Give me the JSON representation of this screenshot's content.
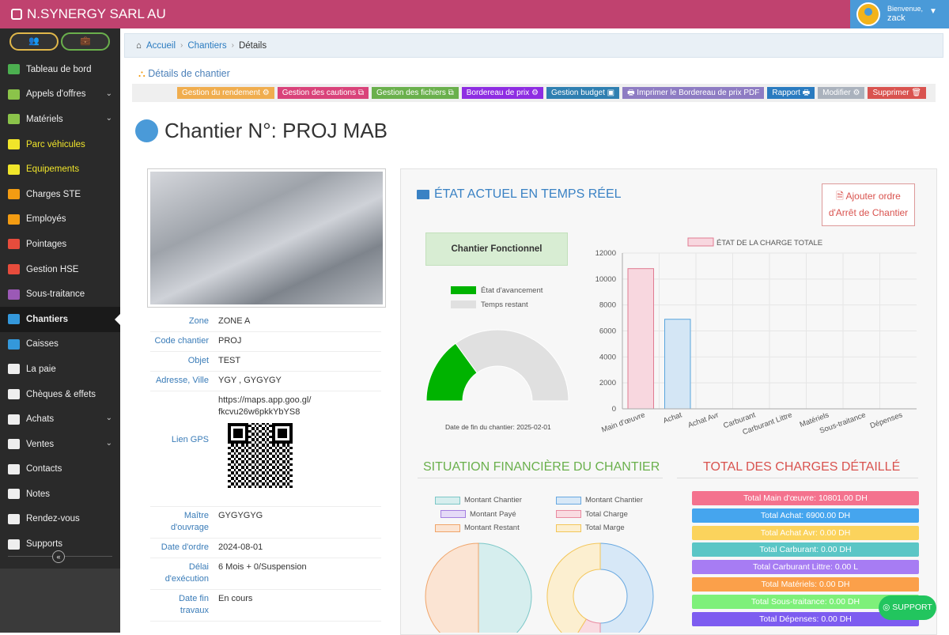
{
  "app": {
    "title": "N.SYNERGY SARL AU"
  },
  "user": {
    "greeting": "Bienvenue,",
    "name": "zack"
  },
  "sidebar": {
    "items": [
      {
        "label": "Tableau de bord",
        "icon": "dashboard-icon",
        "color": "#4caf50",
        "chev": false
      },
      {
        "label": "Appels d'offres",
        "icon": "globe-icon",
        "color": "#8bc34a",
        "chev": true
      },
      {
        "label": "Matériels",
        "icon": "tool-icon",
        "color": "#8bc34a",
        "chev": true
      },
      {
        "label": "Parc véhicules",
        "icon": "car-icon",
        "color": "#f0e52a",
        "chev": false
      },
      {
        "label": "Equipements",
        "icon": "list-icon",
        "color": "#f0e52a",
        "chev": false
      },
      {
        "label": "Charges STE",
        "icon": "building-icon",
        "color": "#f39c12",
        "chev": false
      },
      {
        "label": "Employés",
        "icon": "users-icon",
        "color": "#f39c12",
        "chev": false
      },
      {
        "label": "Pointages",
        "icon": "calendar-icon",
        "color": "#e74c3c",
        "chev": false
      },
      {
        "label": "Gestion HSE",
        "icon": "warning-icon",
        "color": "#e74c3c",
        "chev": false
      },
      {
        "label": "Sous-traitance",
        "icon": "sitemap-icon",
        "color": "#9b59b6",
        "chev": false
      },
      {
        "label": "Chantiers",
        "icon": "castle-icon",
        "color": "#3498db",
        "chev": false
      },
      {
        "label": "Caisses",
        "icon": "briefcase-icon",
        "color": "#3498db",
        "chev": false
      },
      {
        "label": "La paie",
        "icon": "money-icon",
        "color": "#eee",
        "chev": false
      },
      {
        "label": "Chèques & effets",
        "icon": "book-icon",
        "color": "#eee",
        "chev": false
      },
      {
        "label": "Achats",
        "icon": "stack-icon",
        "color": "#eee",
        "chev": true
      },
      {
        "label": "Ventes",
        "icon": "yelp-icon",
        "color": "#eee",
        "chev": true
      },
      {
        "label": "Contacts",
        "icon": "phone-icon",
        "color": "#eee",
        "chev": false
      },
      {
        "label": "Notes",
        "icon": "bulb-icon",
        "color": "#eee",
        "chev": false
      },
      {
        "label": "Rendez-vous",
        "icon": "chat-icon",
        "color": "#eee",
        "chev": false
      },
      {
        "label": "Supports",
        "icon": "lifering-icon",
        "color": "#eee",
        "chev": false
      }
    ]
  },
  "breadcrumb": {
    "home": "Accueil",
    "section": "Chantiers",
    "current": "Détails"
  },
  "details": {
    "title": "Détails de chantier"
  },
  "actions": [
    {
      "label": "Gestion du rendement ⚙",
      "color": "#f0ad4e"
    },
    {
      "label": "Gestion des cautions ⧉",
      "color": "#d9437a"
    },
    {
      "label": "Gestion des fichiers ⧉",
      "color": "#6ab04c"
    },
    {
      "label": "Bordereau de prix ⚙",
      "color": "#8e2de2"
    },
    {
      "label": "Gestion budget ▣",
      "color": "#2f7fb1"
    },
    {
      "label": "🖶 Imprimer le Bordereau de prix PDF",
      "color": "#8e7cc3"
    },
    {
      "label": "Rapport 🖶",
      "color": "#2a7bc0"
    },
    {
      "label": "Modifier ⚙",
      "color": "#aab2bd"
    },
    {
      "label": "Supprimer 🗑",
      "color": "#d9534f"
    }
  ],
  "project": {
    "title": "Chantier N°: PROJ MAB",
    "fields": [
      {
        "key": "Zone",
        "value": "ZONE A"
      },
      {
        "key": "Code chantier",
        "value": "PROJ"
      },
      {
        "key": "Objet",
        "value": "TEST"
      },
      {
        "key": "Adresse, Ville",
        "value": "YGY ,  GYGYGY"
      }
    ],
    "gps_label": "Lien GPS",
    "gps_url": "https://maps.app.goo.gl/ fkcvu26w6pkkYbYS8",
    "fields2": [
      {
        "key": "Maître d'ouvrage",
        "value": "GYGYGYG"
      },
      {
        "key": "Date d'ordre",
        "value": "2024-08-01"
      },
      {
        "key": "Délai d'exécution",
        "value": "6 Mois + 0/Suspension"
      },
      {
        "key": "Date fin travaux",
        "value": "En cours"
      }
    ]
  },
  "etat": {
    "title": "ÉTAT ACTUEL EN TEMPS RÉEL",
    "arret_button": "Ajouter ordre d'Arrêt de Chantier",
    "status": "Chantier Fonctionnel",
    "legend_avancement": "État d'avancement",
    "legend_restant": "Temps restant",
    "date_fin": "Date de fin du chantier: 2025-02-01"
  },
  "chart_data": [
    {
      "type": "gauge",
      "series": [
        {
          "name": "État d'avancement",
          "value": 0.3,
          "color": "#00b300"
        },
        {
          "name": "Temps restant",
          "value": 0.7,
          "color": "#e0e0e0"
        }
      ]
    },
    {
      "type": "bar",
      "title": "ÉTAT DE LA CHARGE TOTALE",
      "categories": [
        "Main d'œuvre",
        "Achat",
        "Achat Avr",
        "Carburant",
        "Carburant Littre",
        "Matériels",
        "Sous-traitance",
        "Dépenses"
      ],
      "values": [
        10801,
        6900,
        0,
        0,
        0,
        0,
        0,
        0
      ],
      "colors": [
        "#f8d7df",
        "#d4e6f5",
        "#fff",
        "#fff",
        "#fff",
        "#fff",
        "#fff",
        "#fff"
      ],
      "borders": [
        "#e07b92",
        "#5aa5dd",
        "#ccc",
        "#ccc",
        "#ccc",
        "#ccc",
        "#ccc",
        "#ccc"
      ],
      "ylim": [
        0,
        12000
      ],
      "yticks": [
        "0",
        "2000",
        "4000",
        "6000",
        "8000",
        "10000",
        "12000"
      ]
    },
    {
      "type": "pie",
      "legend": [
        {
          "name": "Montant Chantier",
          "fill": "#d6eeee",
          "stroke": "#7cc7c7"
        },
        {
          "name": "Montant Chantier",
          "fill": "#d7e8f7",
          "stroke": "#68a8e0"
        },
        {
          "name": "Montant Payé",
          "fill": "#e5daf7",
          "stroke": "#a47ee0"
        },
        {
          "name": "Total Charge",
          "fill": "#f9dbe1",
          "stroke": "#e98aa0"
        },
        {
          "name": "Montant Restant",
          "fill": "#fbe4d3",
          "stroke": "#f0a56a"
        },
        {
          "name": "Total Marge",
          "fill": "#fcefd0",
          "stroke": "#f3c65a"
        }
      ]
    }
  ],
  "situation": {
    "title": "SITUATION FINANCIÈRE DU CHANTIER"
  },
  "totals": {
    "title": "TOTAL DES CHARGES DÉTAILLÉ",
    "items": [
      {
        "label": "Total Main d'œuvre: 10801.00 DH",
        "color": "#f4728e"
      },
      {
        "label": "Total Achat: 6900.00 DH",
        "color": "#45a5ee"
      },
      {
        "label": "Total Achat Avr: 0.00 DH",
        "color": "#fbd35c"
      },
      {
        "label": "Total Carburant: 0.00 DH",
        "color": "#5bc6c6"
      },
      {
        "label": "Total Carburant Littre: 0.00 L",
        "color": "#a77cf3"
      },
      {
        "label": "Total Matériels: 0.00 DH",
        "color": "#fba04a"
      },
      {
        "label": "Total Sous-traitance: 0.00 DH",
        "color": "#7ef07a"
      },
      {
        "label": "Total Dépenses: 0.00 DH",
        "color": "#7d5cf0"
      }
    ]
  },
  "support": {
    "label": "◎ SUPPORT"
  }
}
